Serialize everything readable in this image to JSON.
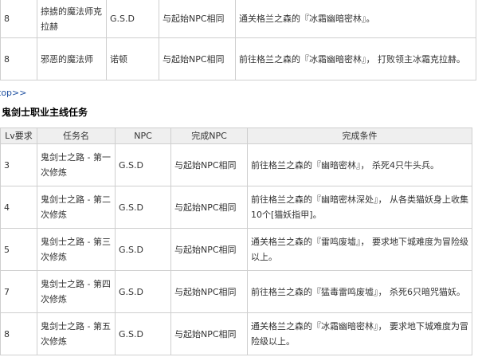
{
  "top_rows": [
    {
      "lv": "8",
      "name": "掠掳的魔法师克拉赫",
      "npc": "G.S.D",
      "finish_npc": "与起始NPC相同",
      "condition": "通关格兰之森的『冰霜幽暗密林』。"
    },
    {
      "lv": "8",
      "name": "邪恶的魔法师",
      "npc": "诺顿",
      "finish_npc": "与起始NPC相同",
      "condition": "前往格兰之森的『冰霜幽暗密林』， 打败领主冰霜克拉赫。"
    }
  ],
  "back_link": "top>>",
  "section_title": "鬼剑士职业主线任务",
  "headers": {
    "lv": "Lv要求",
    "name": "任务名",
    "npc": "NPC",
    "finish_npc": "完成NPC",
    "condition": "完成条件"
  },
  "rows": [
    {
      "lv": "3",
      "name": "鬼剑士之路 - 第一次修炼",
      "npc": "G.S.D",
      "finish_npc": "与起始NPC相同",
      "condition": "前往格兰之森的『幽暗密林』， 杀死4只牛头兵。"
    },
    {
      "lv": "4",
      "name": "鬼剑士之路 - 第二次修炼",
      "npc": "G.S.D",
      "finish_npc": "与起始NPC相同",
      "condition": "前往格兰之森的『幽暗密林深处』， 从各类猫妖身上收集10个[猫妖指甲]。"
    },
    {
      "lv": "5",
      "name": "鬼剑士之路 - 第三次修炼",
      "npc": "G.S.D",
      "finish_npc": "与起始NPC相同",
      "condition": "通关格兰之森的『雷鸣废墟』， 要求地下城难度为冒险级以上。"
    },
    {
      "lv": "7",
      "name": "鬼剑士之路 - 第四次修炼",
      "npc": "G.S.D",
      "finish_npc": "与起始NPC相同",
      "condition": "前往格兰之森的『猛毒雷鸣废墟』， 杀死6只暗咒猫妖。"
    },
    {
      "lv": "8",
      "name": "鬼剑士之路 - 第五次修炼",
      "npc": "G.S.D",
      "finish_npc": "与起始NPC相同",
      "condition": "通关格兰之森的『冰霜幽暗密林』， 要求地下城难度为冒险级以上。"
    }
  ]
}
